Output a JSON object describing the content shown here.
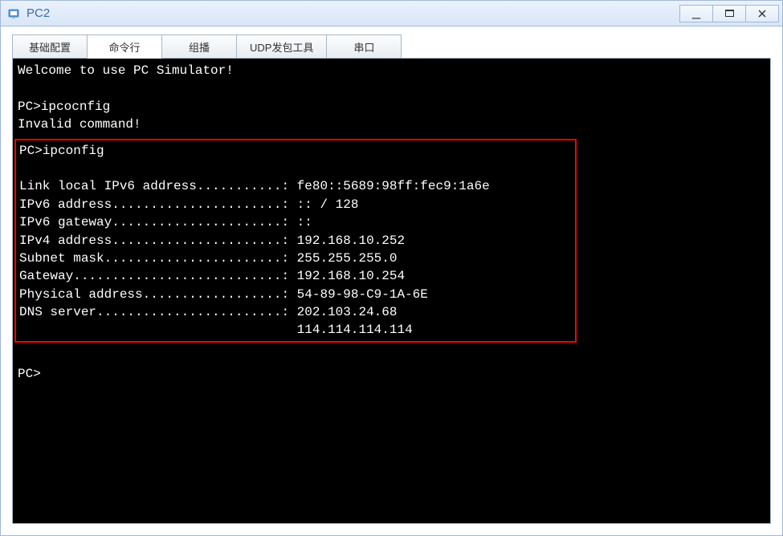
{
  "window": {
    "title": "PC2"
  },
  "tabs": [
    {
      "label": "基础配置",
      "active": false
    },
    {
      "label": "命令行",
      "active": true
    },
    {
      "label": "组播",
      "active": false
    },
    {
      "label": "UDP发包工具",
      "active": false
    },
    {
      "label": "串口",
      "active": false
    }
  ],
  "terminal": {
    "welcome": "Welcome to use PC Simulator!",
    "prompt": "PC>",
    "cmd1": "ipcocnfig",
    "invalid": "Invalid command!",
    "cmd2": "ipconfig",
    "lines": {
      "l1": "Link local IPv6 address...........: fe80::5689:98ff:fec9:1a6e",
      "l2": "IPv6 address......................: :: / 128",
      "l3": "IPv6 gateway......................: ::",
      "l4": "IPv4 address......................: 192.168.10.252",
      "l5": "Subnet mask.......................: 255.255.255.0",
      "l6": "Gateway...........................: 192.168.10.254",
      "l7": "Physical address..................: 54-89-98-C9-1A-6E",
      "l8": "DNS server........................: 202.103.24.68",
      "l9": "                                    114.114.114.114"
    }
  }
}
